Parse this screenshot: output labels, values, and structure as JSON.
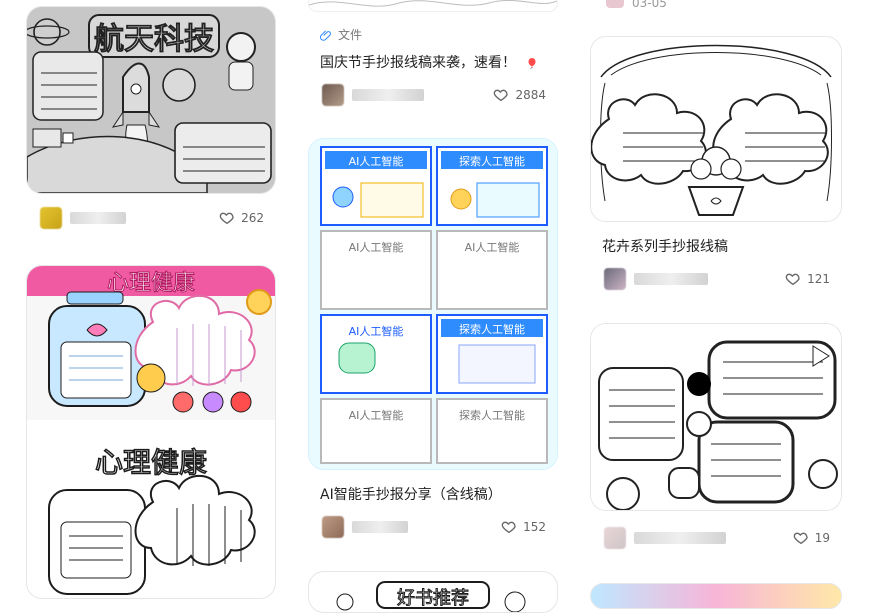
{
  "cards": [
    {
      "image_title": "航天科技",
      "likes": "262"
    },
    {
      "image_title_top": "心理健康",
      "image_title_bottom": "心理健康"
    },
    {
      "tag": "文件",
      "title": "国庆节手抄报线稿来袭，速看！",
      "likes": "2884"
    },
    {
      "title": "AI智能手抄报分享（含线稿）",
      "likes": "152",
      "poster_labels": [
        "AI人工智能",
        "探索人工智能",
        "AI人工智能",
        "AI人工智能",
        "AI人工智能",
        "探索人工智能",
        "AI人工智能",
        "探索人工智能"
      ]
    },
    {
      "image_title": "好书推荐"
    },
    {
      "date": "03-05"
    },
    {
      "title": "花卉系列手抄报线稿",
      "likes": "121"
    },
    {
      "likes": "19"
    }
  ]
}
